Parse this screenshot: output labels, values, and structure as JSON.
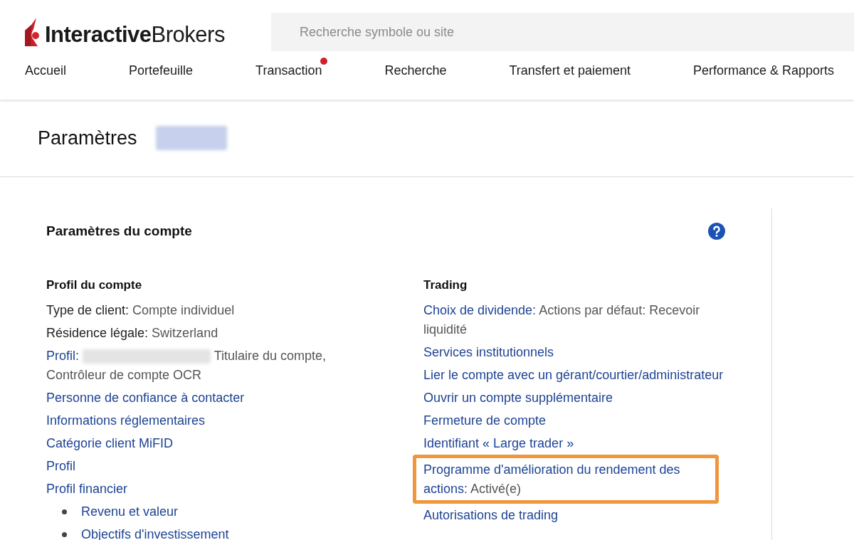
{
  "logo": {
    "text": "**Interactive**Brokers"
  },
  "search": {
    "placeholder": "Recherche symbole ou site"
  },
  "nav": [
    {
      "label": "Accueil",
      "notification": false
    },
    {
      "label": "Portefeuille",
      "notification": false
    },
    {
      "label": "Transaction",
      "notification": true
    },
    {
      "label": "Recherche",
      "notification": false
    },
    {
      "label": "Transfert et paiement",
      "notification": false
    },
    {
      "label": "Performance & Rapports",
      "notification": false
    }
  ],
  "page_title": {
    "text": "Paramètres",
    "redacted": true
  },
  "panel": {
    "title": "Paramètres du compte",
    "columns": [
      {
        "heading": "Profil du compte",
        "items": [
          {
            "kind": "field",
            "label": "Type de client:",
            "value": "Compte individuel",
            "redacted": false,
            "highlighted": false
          },
          {
            "kind": "field",
            "label": "Résidence légale:",
            "value": "Switzerland",
            "redacted": false,
            "highlighted": false
          },
          {
            "kind": "link_value",
            "label": "Profil:",
            "value": "Titulaire du compte, Contrôleur de compte OCR",
            "redacted": true,
            "highlighted": false
          },
          {
            "kind": "link",
            "label": "Personne de confiance à contacter",
            "redacted": false,
            "highlighted": false
          },
          {
            "kind": "link",
            "label": "Informations réglementaires",
            "redacted": false,
            "highlighted": false
          },
          {
            "kind": "link",
            "label": "Catégorie client MiFID",
            "redacted": false,
            "highlighted": false
          },
          {
            "kind": "link",
            "label": "Profil",
            "redacted": false,
            "highlighted": false
          },
          {
            "kind": "link",
            "label": "Profil financier",
            "redacted": false,
            "highlighted": false,
            "children": [
              {
                "label": "Revenu et valeur"
              },
              {
                "label": "Objectifs d'investissement"
              }
            ]
          }
        ]
      },
      {
        "heading": "Trading",
        "items": [
          {
            "kind": "link_value",
            "label": "Choix de dividende:",
            "value": "Actions par défaut: Recevoir liquidité",
            "redacted": false,
            "highlighted": false
          },
          {
            "kind": "link",
            "label": "Services institutionnels",
            "redacted": false,
            "highlighted": false
          },
          {
            "kind": "link",
            "label": "Lier le compte avec un gérant/courtier/administrateur",
            "redacted": false,
            "highlighted": false
          },
          {
            "kind": "link",
            "label": "Ouvrir un compte supplémentaire",
            "redacted": false,
            "highlighted": false
          },
          {
            "kind": "link",
            "label": "Fermeture de compte",
            "redacted": false,
            "highlighted": false
          },
          {
            "kind": "link",
            "label": "Identifiant « Large trader »",
            "redacted": false,
            "highlighted": false
          },
          {
            "kind": "link_value",
            "label": "Programme d'amélioration du rendement des actions:",
            "value": "Activé(e)",
            "redacted": false,
            "highlighted": true
          },
          {
            "kind": "link",
            "label": "Autorisations de trading",
            "redacted": false,
            "highlighted": false
          }
        ]
      }
    ]
  }
}
